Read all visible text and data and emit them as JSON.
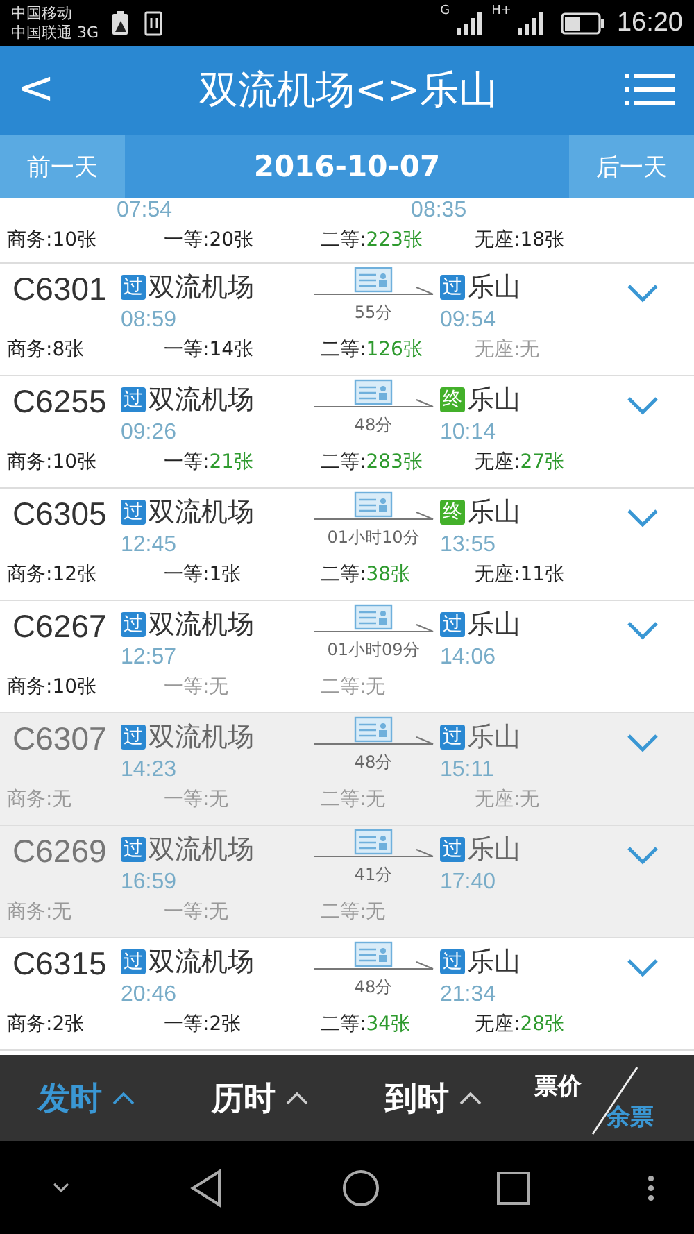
{
  "status_bar": {
    "carriers": [
      "中国移动",
      "中国联通 3G"
    ],
    "signal_labels": [
      "G",
      "H+"
    ],
    "time": "16:20"
  },
  "header": {
    "back": "<",
    "title": "双流机场<>乐山"
  },
  "date_bar": {
    "prev": "前一天",
    "date": "2016-10-07",
    "next": "后一天"
  },
  "trains": [
    {
      "kind": "partial",
      "depart_time": "07:54",
      "arrive_time": "08:35",
      "sold_out": false,
      "seats": [
        {
          "label": "商务:",
          "value": "10张",
          "sold_out": false,
          "plenty": false
        },
        {
          "label": "一等:",
          "value": "20张",
          "sold_out": false,
          "plenty": false
        },
        {
          "label": "二等:",
          "value": "223张",
          "sold_out": false,
          "plenty": true
        },
        {
          "label": "无座:",
          "value": "18张",
          "sold_out": false,
          "plenty": false
        }
      ]
    },
    {
      "kind": "full",
      "number": "C6301",
      "from_badge": "过",
      "from_terminal": false,
      "from": "双流机场",
      "depart_time": "08:59",
      "duration": "55分",
      "to_badge": "过",
      "to_terminal": false,
      "to": "乐山",
      "arrive_time": "09:54",
      "sold_out": false,
      "seats": [
        {
          "label": "商务:",
          "value": "8张",
          "sold_out": false,
          "plenty": false
        },
        {
          "label": "一等:",
          "value": "14张",
          "sold_out": false,
          "plenty": false
        },
        {
          "label": "二等:",
          "value": "126张",
          "sold_out": false,
          "plenty": true
        },
        {
          "label": "无座:",
          "value": "无",
          "sold_out": true,
          "plenty": false
        }
      ]
    },
    {
      "kind": "full",
      "number": "C6255",
      "from_badge": "过",
      "from_terminal": false,
      "from": "双流机场",
      "depart_time": "09:26",
      "duration": "48分",
      "to_badge": "终",
      "to_terminal": true,
      "to": "乐山",
      "arrive_time": "10:14",
      "sold_out": false,
      "seats": [
        {
          "label": "商务:",
          "value": "10张",
          "sold_out": false,
          "plenty": false
        },
        {
          "label": "一等:",
          "value": "21张",
          "sold_out": false,
          "plenty": true
        },
        {
          "label": "二等:",
          "value": "283张",
          "sold_out": false,
          "plenty": true
        },
        {
          "label": "无座:",
          "value": "27张",
          "sold_out": false,
          "plenty": true
        }
      ]
    },
    {
      "kind": "full",
      "number": "C6305",
      "from_badge": "过",
      "from_terminal": false,
      "from": "双流机场",
      "depart_time": "12:45",
      "duration": "01小时10分",
      "to_badge": "终",
      "to_terminal": true,
      "to": "乐山",
      "arrive_time": "13:55",
      "sold_out": false,
      "seats": [
        {
          "label": "商务:",
          "value": "12张",
          "sold_out": false,
          "plenty": false
        },
        {
          "label": "一等:",
          "value": "1张",
          "sold_out": false,
          "plenty": false
        },
        {
          "label": "二等:",
          "value": "38张",
          "sold_out": false,
          "plenty": true
        },
        {
          "label": "无座:",
          "value": "11张",
          "sold_out": false,
          "plenty": false
        }
      ]
    },
    {
      "kind": "full",
      "number": "C6267",
      "from_badge": "过",
      "from_terminal": false,
      "from": "双流机场",
      "depart_time": "12:57",
      "duration": "01小时09分",
      "to_badge": "过",
      "to_terminal": false,
      "to": "乐山",
      "arrive_time": "14:06",
      "sold_out": false,
      "seats": [
        {
          "label": "商务:",
          "value": "10张",
          "sold_out": false,
          "plenty": false
        },
        {
          "label": "一等:",
          "value": "无",
          "sold_out": true,
          "plenty": false
        },
        {
          "label": "二等:",
          "value": "无",
          "sold_out": true,
          "plenty": false
        }
      ]
    },
    {
      "kind": "full",
      "number": "C6307",
      "from_badge": "过",
      "from_terminal": false,
      "from": "双流机场",
      "depart_time": "14:23",
      "duration": "48分",
      "to_badge": "过",
      "to_terminal": false,
      "to": "乐山",
      "arrive_time": "15:11",
      "sold_out": true,
      "seats": [
        {
          "label": "商务:",
          "value": "无",
          "sold_out": true,
          "plenty": false
        },
        {
          "label": "一等:",
          "value": "无",
          "sold_out": true,
          "plenty": false
        },
        {
          "label": "二等:",
          "value": "无",
          "sold_out": true,
          "plenty": false
        },
        {
          "label": "无座:",
          "value": "无",
          "sold_out": true,
          "plenty": false
        }
      ]
    },
    {
      "kind": "full",
      "number": "C6269",
      "from_badge": "过",
      "from_terminal": false,
      "from": "双流机场",
      "depart_time": "16:59",
      "duration": "41分",
      "to_badge": "过",
      "to_terminal": false,
      "to": "乐山",
      "arrive_time": "17:40",
      "sold_out": true,
      "seats": [
        {
          "label": "商务:",
          "value": "无",
          "sold_out": true,
          "plenty": false
        },
        {
          "label": "一等:",
          "value": "无",
          "sold_out": true,
          "plenty": false
        },
        {
          "label": "二等:",
          "value": "无",
          "sold_out": true,
          "plenty": false
        }
      ]
    },
    {
      "kind": "full",
      "number": "C6315",
      "from_badge": "过",
      "from_terminal": false,
      "from": "双流机场",
      "depart_time": "20:46",
      "duration": "48分",
      "to_badge": "过",
      "to_terminal": false,
      "to": "乐山",
      "arrive_time": "21:34",
      "sold_out": false,
      "seats": [
        {
          "label": "商务:",
          "value": "2张",
          "sold_out": false,
          "plenty": false
        },
        {
          "label": "一等:",
          "value": "2张",
          "sold_out": false,
          "plenty": false
        },
        {
          "label": "二等:",
          "value": "34张",
          "sold_out": false,
          "plenty": true
        },
        {
          "label": "无座:",
          "value": "28张",
          "sold_out": false,
          "plenty": true
        }
      ]
    }
  ],
  "sort_bar": [
    {
      "kind": "caret",
      "label": "发时",
      "selected": true
    },
    {
      "kind": "caret",
      "label": "历时",
      "selected": false
    },
    {
      "kind": "caret",
      "label": "到时",
      "selected": false
    },
    {
      "kind": "split",
      "top": "票价",
      "bottom": "余票",
      "selected": false
    }
  ]
}
